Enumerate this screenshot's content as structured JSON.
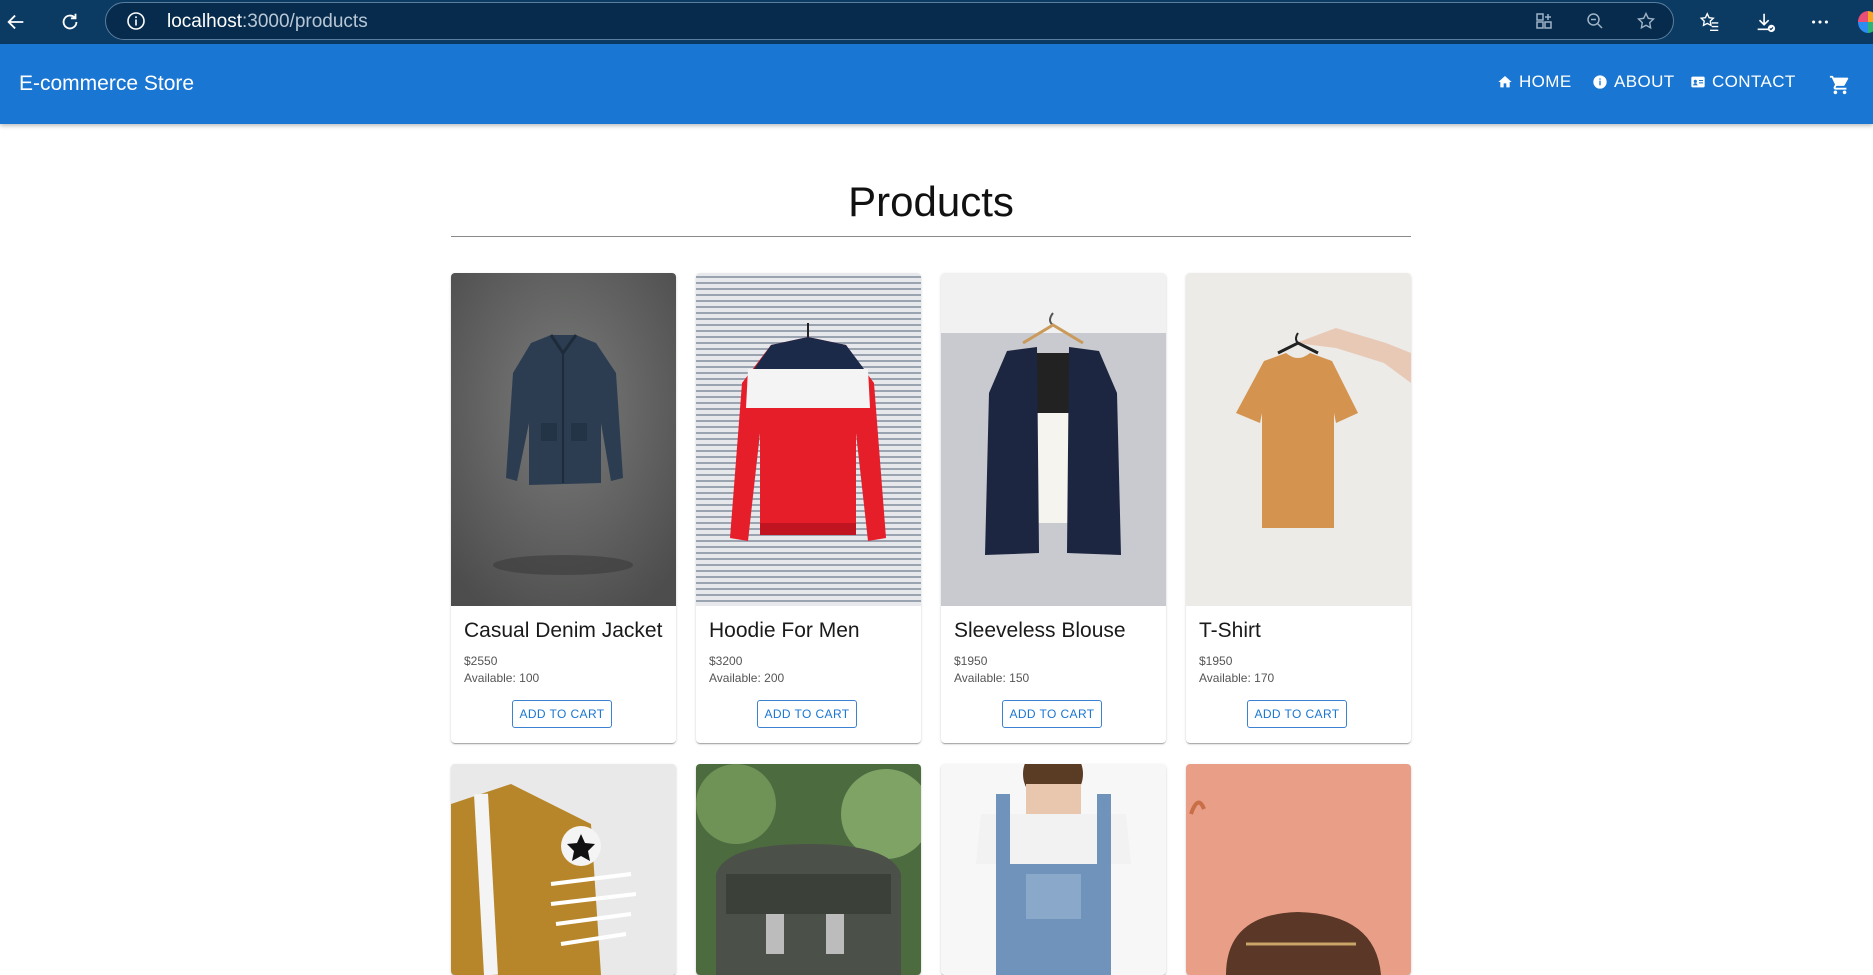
{
  "browser": {
    "url_host": "localhost",
    "url_port": ":3000",
    "url_path": "/products"
  },
  "appbar": {
    "brand": "E-commerce Store",
    "nav": [
      {
        "label": "HOME",
        "icon": "home-icon"
      },
      {
        "label": "ABOUT",
        "icon": "info-icon"
      },
      {
        "label": "CONTACT",
        "icon": "contact-card-icon"
      }
    ],
    "cart_icon": "shopping-cart-icon",
    "color": "#1976d2"
  },
  "page": {
    "title": "Products"
  },
  "products": [
    {
      "name": "Casual Denim Jacket",
      "price": "$2550",
      "available": "Available: 100",
      "button": "ADD TO CART"
    },
    {
      "name": "Hoodie For Men",
      "price": "$3200",
      "available": "Available: 200",
      "button": "ADD TO CART"
    },
    {
      "name": "Sleeveless Blouse",
      "price": "$1950",
      "available": "Available: 150",
      "button": "ADD TO CART"
    },
    {
      "name": "T-Shirt",
      "price": "$1950",
      "available": "Available: 170",
      "button": "ADD TO CART"
    }
  ]
}
